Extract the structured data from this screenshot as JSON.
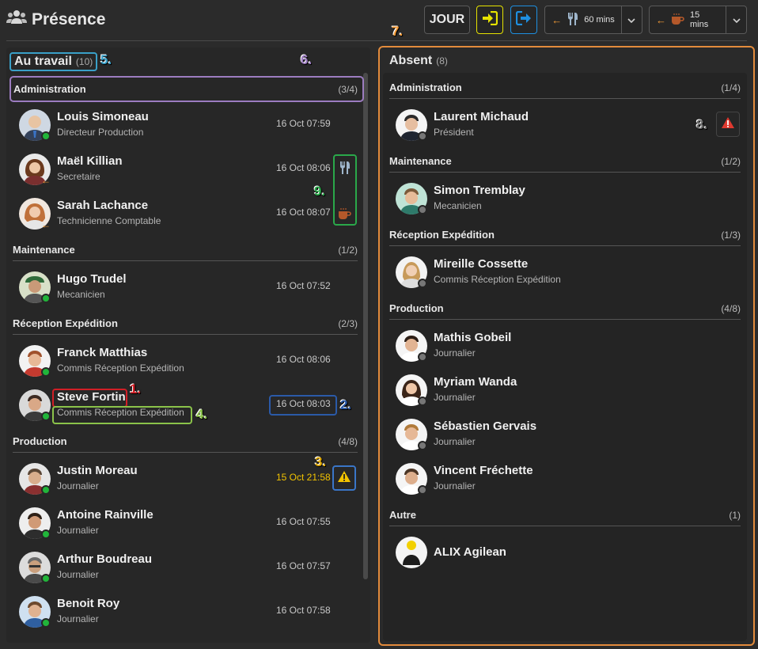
{
  "header": {
    "title": "Présence",
    "day_label": "JOUR",
    "meal_timer": "60 mins",
    "break_timer": "15 mins"
  },
  "markers": [
    "1.",
    "2.",
    "3.",
    "4.",
    "5.",
    "6.",
    "7.",
    "8.",
    "9."
  ],
  "at_work": {
    "title": "Au travail",
    "count": "(10)",
    "groups": [
      {
        "name": "Administration",
        "count": "(3/4)",
        "employees": [
          {
            "name": "Louis Simoneau",
            "role": "Directeur Production",
            "time": "16 Oct 07:59"
          },
          {
            "name": "Maël Killian",
            "role": "Secretaire",
            "time": "16 Oct 08:06"
          },
          {
            "name": "Sarah Lachance",
            "role": "Technicienne Comptable",
            "time": "16 Oct 08:07"
          }
        ]
      },
      {
        "name": "Maintenance",
        "count": "(1/2)",
        "employees": [
          {
            "name": "Hugo Trudel",
            "role": "Mecanicien",
            "time": "16 Oct 07:52"
          }
        ]
      },
      {
        "name": "Réception Expédition",
        "count": "(2/3)",
        "employees": [
          {
            "name": "Franck Matthias",
            "role": "Commis Réception Expédition",
            "time": "16 Oct 08:06"
          },
          {
            "name": "Steve Fortin",
            "role": "Commis Réception Expédition",
            "time": "16 Oct 08:03"
          }
        ]
      },
      {
        "name": "Production",
        "count": "(4/8)",
        "employees": [
          {
            "name": "Justin Moreau",
            "role": "Journalier",
            "time": "15 Oct 21:58"
          },
          {
            "name": "Antoine Rainville",
            "role": "Journalier",
            "time": "16 Oct 07:55"
          },
          {
            "name": "Arthur Boudreau",
            "role": "Journalier",
            "time": "16 Oct 07:57"
          },
          {
            "name": "Benoit Roy",
            "role": "Journalier",
            "time": "16 Oct 07:58"
          }
        ]
      }
    ]
  },
  "absent": {
    "title": "Absent",
    "count": "(8)",
    "groups": [
      {
        "name": "Administration",
        "count": "(1/4)",
        "employees": [
          {
            "name": "Laurent Michaud",
            "role": "Président"
          }
        ]
      },
      {
        "name": "Maintenance",
        "count": "(1/2)",
        "employees": [
          {
            "name": "Simon Tremblay",
            "role": "Mecanicien"
          }
        ]
      },
      {
        "name": "Réception Expédition",
        "count": "(1/3)",
        "employees": [
          {
            "name": "Mireille Cossette",
            "role": "Commis Réception Expédition"
          }
        ]
      },
      {
        "name": "Production",
        "count": "(4/8)",
        "employees": [
          {
            "name": "Mathis Gobeil",
            "role": "Journalier"
          },
          {
            "name": "Myriam Wanda",
            "role": "Journalier"
          },
          {
            "name": "Sébastien Gervais",
            "role": "Journalier"
          },
          {
            "name": "Vincent Fréchette",
            "role": "Journalier"
          }
        ]
      },
      {
        "name": "Autre",
        "count": "(1)",
        "employees": [
          {
            "name": "ALIX Agilean",
            "role": ""
          }
        ]
      }
    ]
  },
  "colors": {
    "background": "#2b2b2b",
    "present": "#21b53a",
    "absent": "#777777",
    "late_time": "#f2c300",
    "punch_in": "#e7e300",
    "punch_out": "#1e8fe0",
    "absent_panel_border": "#e38b3c"
  },
  "icons": [
    "users-icon",
    "punch-in-icon",
    "punch-out-icon",
    "fork-knife-icon",
    "coffee-icon",
    "warning-icon",
    "chevron-down-icon",
    "arrow-left-icon"
  ]
}
